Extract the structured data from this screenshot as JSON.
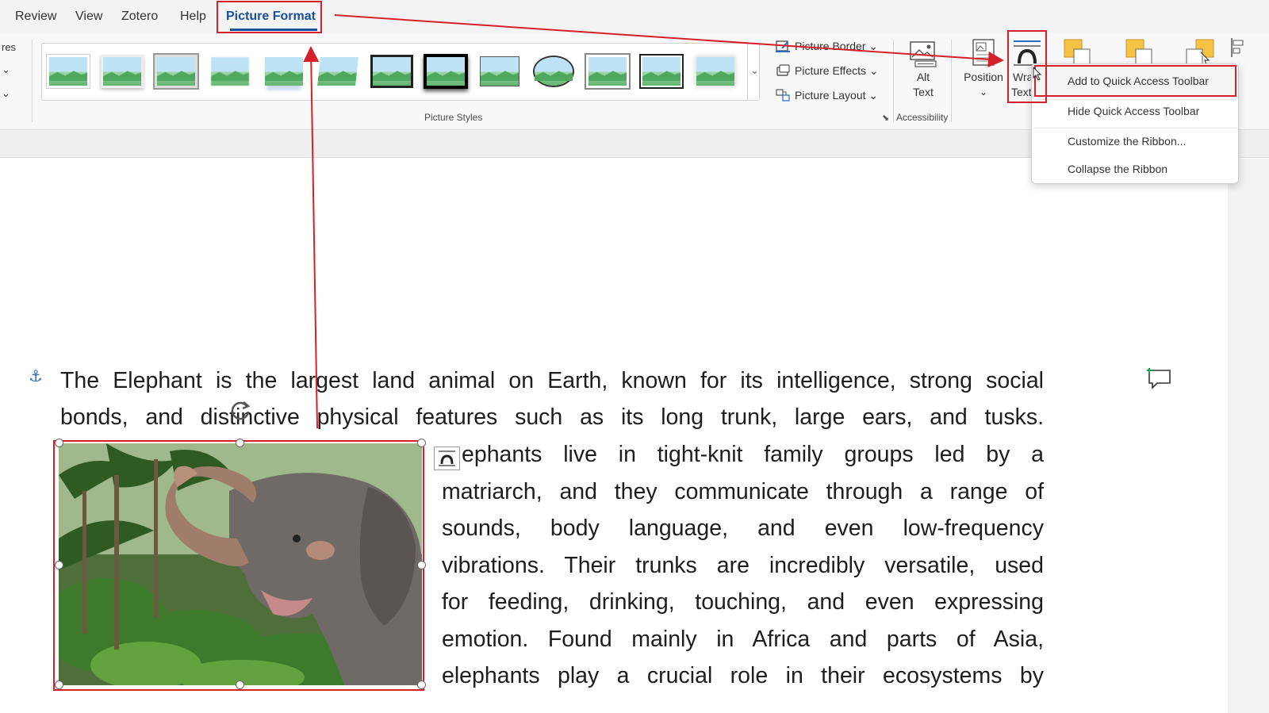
{
  "tabs": [
    "Review",
    "View",
    "Zotero",
    "Help",
    "Picture Format"
  ],
  "ribbon": {
    "cut_labels": [
      "res",
      "⌄",
      "⌄"
    ],
    "picture_styles_label": "Picture Styles",
    "gallery_more": "⌄",
    "picture_border": "Picture Border ⌄",
    "picture_effects": "Picture Effects ⌄",
    "picture_layout": "Picture Layout ⌄",
    "alt_text_1": "Alt",
    "alt_text_2": "Text",
    "accessibility_label": "Accessibility",
    "position_label": "Position",
    "position_caret": "⌄",
    "wrap_text_1": "Wra",
    "wrap_text_2": "Text"
  },
  "context_menu": {
    "items": [
      "Add to Quick Access Toolbar",
      "Hide Quick Access Toolbar",
      "Customize the Ribbon...",
      "Collapse the Ribbon"
    ]
  },
  "document": {
    "lines_full": [
      "The Elephant is the largest land animal on Earth, known for its intelligence, strong social",
      "bonds, and distinctive physical features such as its long trunk, large ears, and tusks."
    ],
    "lines_wrap": [
      "ephants live in tight-knit family groups led by a",
      "matriarch, and they communicate through a range of",
      "sounds, body language, and even low-frequency",
      "vibrations. Their trunks are incredibly versatile, used",
      "for feeding, drinking, touching, and even expressing",
      "emotion. Found mainly in Africa and parts of Asia,",
      "elephants play a crucial role in their ecosystems by"
    ]
  },
  "colors": {
    "annotation_red": "#d4202a",
    "active_tab_blue": "#1a4f9c"
  }
}
